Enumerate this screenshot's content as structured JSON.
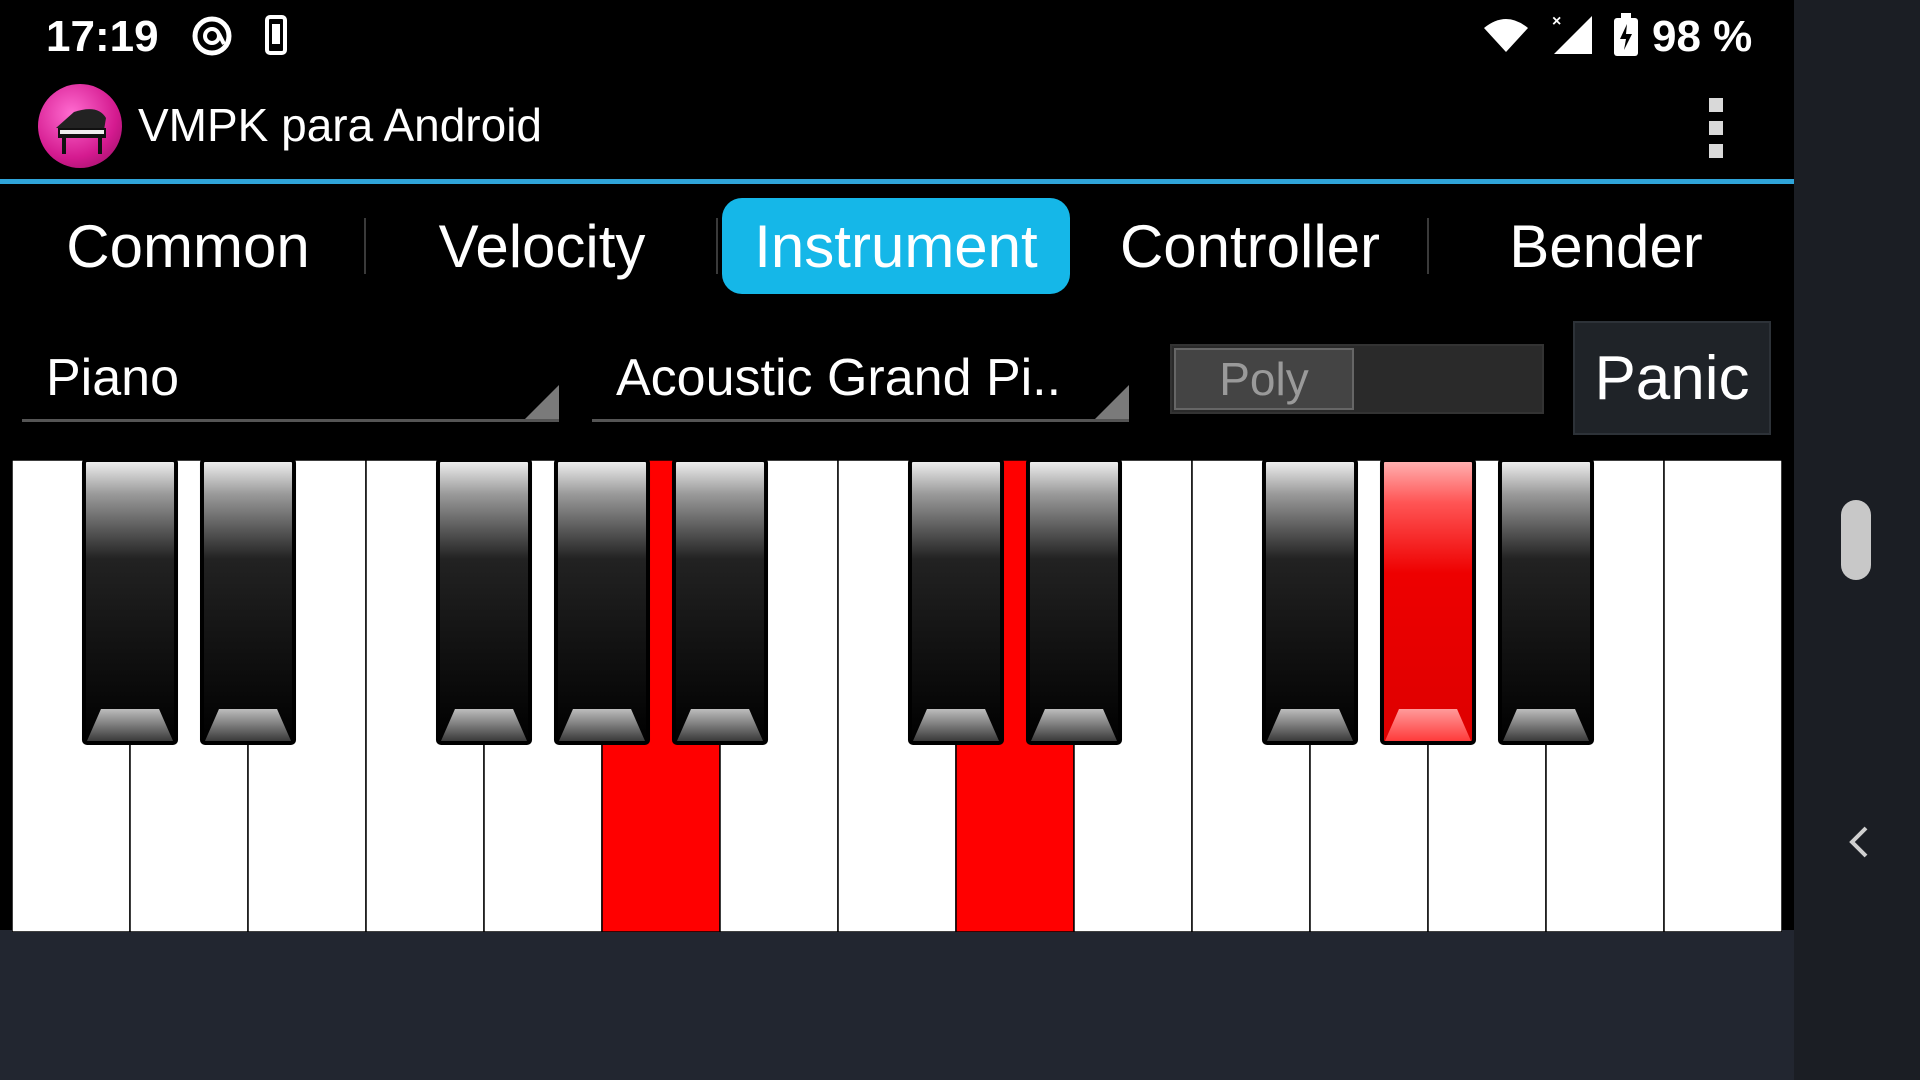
{
  "status_bar": {
    "time": "17:19",
    "battery_percent": "98 %",
    "icons": [
      "at-sign-icon",
      "phone-icon",
      "wifi-icon",
      "cell-signal-icon",
      "battery-charging-icon"
    ]
  },
  "app_bar": {
    "title": "VMPK para Android",
    "logo_icon": "grand-piano-icon",
    "menu_icon": "overflow-menu-icon"
  },
  "tabs": [
    {
      "label": "Common",
      "active": false
    },
    {
      "label": "Velocity",
      "active": false
    },
    {
      "label": "Instrument",
      "active": true
    },
    {
      "label": "Controller",
      "active": false
    },
    {
      "label": "Bender",
      "active": false
    }
  ],
  "instrument_panel": {
    "category_dropdown": {
      "selected": "Piano"
    },
    "program_dropdown": {
      "selected": "Acoustic Grand Pi.."
    },
    "mode_switch": {
      "label": "Poly"
    },
    "panic_button": {
      "label": "Panic"
    }
  },
  "keyboard": {
    "white_key_count": 15,
    "white_pressed": [
      5,
      8
    ],
    "black_keys": [
      {
        "after_white": 0,
        "pressed": false
      },
      {
        "after_white": 1,
        "pressed": false
      },
      {
        "after_white": 3,
        "pressed": false
      },
      {
        "after_white": 4,
        "pressed": false
      },
      {
        "after_white": 5,
        "pressed": false
      },
      {
        "after_white": 7,
        "pressed": false
      },
      {
        "after_white": 8,
        "pressed": false
      },
      {
        "after_white": 10,
        "pressed": false
      },
      {
        "after_white": 11,
        "pressed": true
      },
      {
        "after_white": 12,
        "pressed": false
      }
    ]
  },
  "colors": {
    "accent": "#15b7e8",
    "divider_line": "#2fa4d9",
    "pressed_key": "#ff0000",
    "background": "#222630"
  }
}
